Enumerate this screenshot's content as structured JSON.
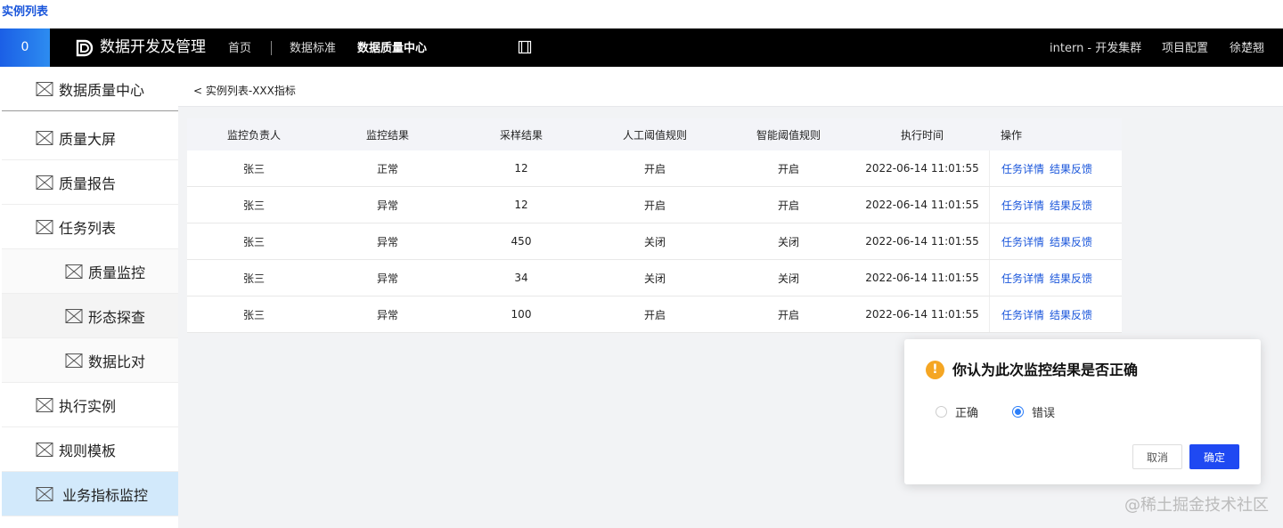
{
  "page_label": "实例列表",
  "topbar": {
    "menu_icon_text": "0",
    "brand": "数据开发及管理",
    "nav": [
      "首页",
      "数据标准",
      "数据质量中心"
    ],
    "cluster": "intern - 开发集群",
    "project_config": "项目配置",
    "user": "徐楚翘"
  },
  "sidebar": {
    "items": [
      {
        "label": "数据质量中心"
      },
      {
        "label": "质量大屏"
      },
      {
        "label": "质量报告"
      },
      {
        "label": "任务列表"
      },
      {
        "label": "质量监控"
      },
      {
        "label": "形态探查"
      },
      {
        "label": "数据比对"
      },
      {
        "label": "执行实例"
      },
      {
        "label": "规则模板"
      },
      {
        "label": "业务指标监控"
      }
    ]
  },
  "breadcrumb": "< 实例列表-XXX指标",
  "table": {
    "headers": [
      "监控负责人",
      "监控结果",
      "采样结果",
      "人工阈值规则",
      "智能阈值规则",
      "执行时间",
      "操作"
    ],
    "rows": [
      {
        "owner": "张三",
        "result": "正常",
        "sample": "12",
        "manual": "开启",
        "smart": "开启",
        "time": "2022-06-14 11:01:55"
      },
      {
        "owner": "张三",
        "result": "异常",
        "sample": "12",
        "manual": "开启",
        "smart": "开启",
        "time": "2022-06-14 11:01:55"
      },
      {
        "owner": "张三",
        "result": "异常",
        "sample": "450",
        "manual": "关闭",
        "smart": "关闭",
        "time": "2022-06-14 11:01:55"
      },
      {
        "owner": "张三",
        "result": "异常",
        "sample": "34",
        "manual": "关闭",
        "smart": "关闭",
        "time": "2022-06-14 11:01:55"
      },
      {
        "owner": "张三",
        "result": "异常",
        "sample": "100",
        "manual": "开启",
        "smart": "开启",
        "time": "2022-06-14 11:01:55"
      }
    ],
    "action_detail": "任务详情",
    "action_feedback": "结果反馈"
  },
  "dialog": {
    "title": "你认为此次监控结果是否正确",
    "option_correct": "正确",
    "option_wrong": "错误",
    "selected": "错误",
    "cancel": "取消",
    "confirm": "确定"
  },
  "watermark": "@稀土掘金技术社区",
  "colors": {
    "accent": "#1f49f2",
    "link": "#1a56db",
    "active_sidebar": "#d2e9fb",
    "warning": "#f5a623"
  }
}
